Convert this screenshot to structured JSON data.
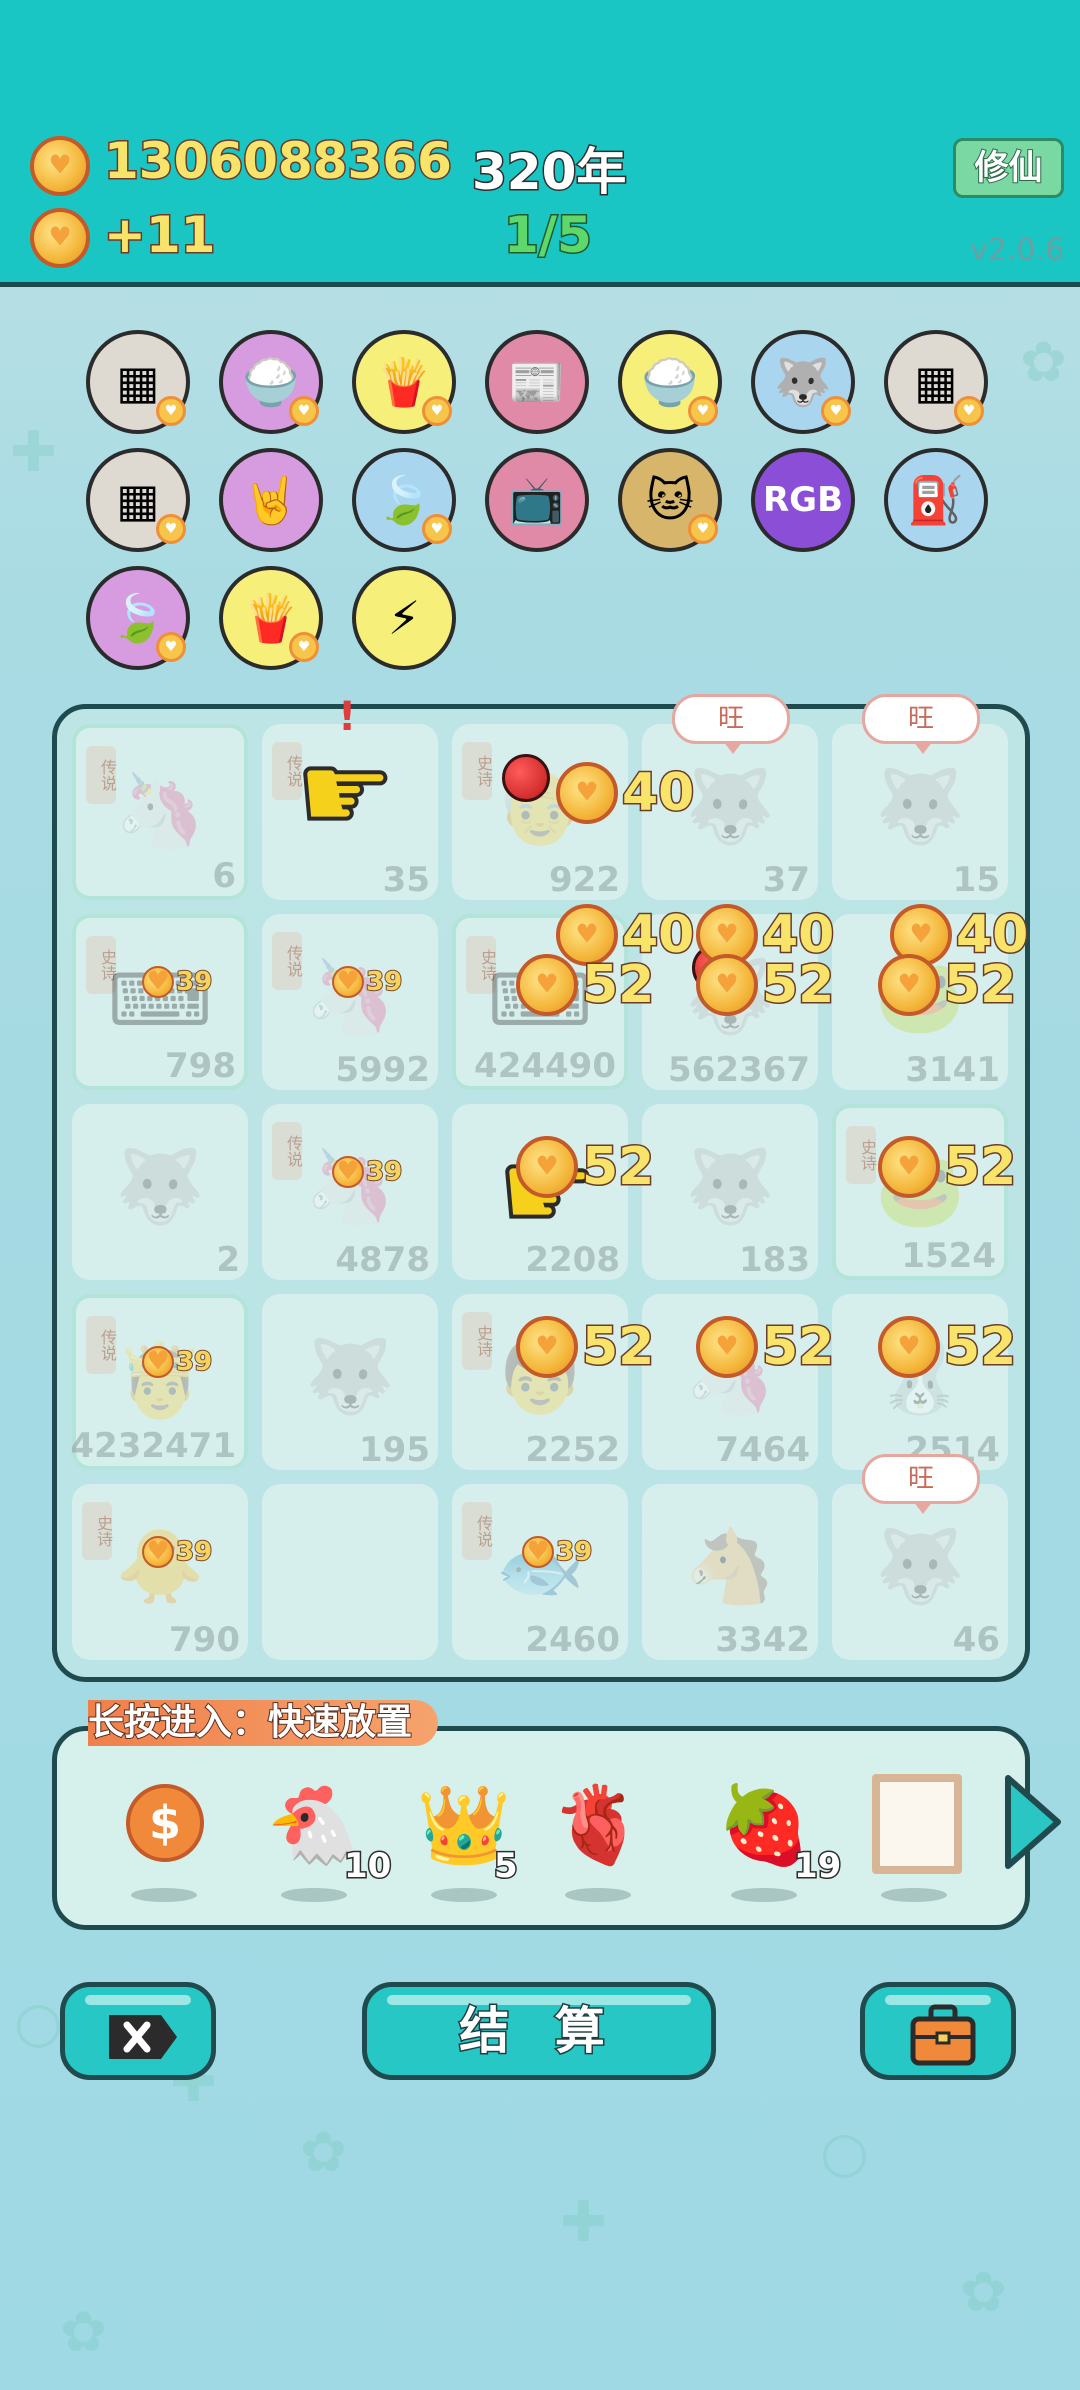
{
  "header": {
    "coins": "1306088366",
    "income": "+11",
    "year": "320年",
    "progress": "1/5",
    "mode_button": "修仙",
    "version": "v2.0.6"
  },
  "collection": {
    "items": [
      {
        "icon": "tofu-cubes-icon",
        "glyph": "▦",
        "bg": "#dedad2",
        "has_coin": true
      },
      {
        "icon": "rice-bowl-icon",
        "glyph": "🍚",
        "bg": "#d79be0",
        "has_coin": true
      },
      {
        "icon": "fries-icon",
        "glyph": "🍟",
        "bg": "#f6f07a",
        "has_coin": true
      },
      {
        "icon": "time-magazine-icon",
        "glyph": "📰",
        "bg": "#e08aa8",
        "has_coin": false
      },
      {
        "icon": "rice-bowl-icon",
        "glyph": "🍚",
        "bg": "#f6f07a",
        "has_coin": true
      },
      {
        "icon": "husky-icon",
        "glyph": "🐺",
        "bg": "#a9d5ee",
        "has_coin": true
      },
      {
        "icon": "tofu-cubes-icon",
        "glyph": "▦",
        "bg": "#dedad2",
        "has_coin": true
      },
      {
        "icon": "tofu-cubes-icon",
        "glyph": "▦",
        "bg": "#dedad2",
        "has_coin": true
      },
      {
        "icon": "rock-hand-icon",
        "glyph": "🤘",
        "bg": "#d79be0",
        "has_coin": false
      },
      {
        "icon": "leaf-icon",
        "glyph": "🍃",
        "bg": "#a9d5ee",
        "has_coin": true
      },
      {
        "icon": "tv-cow-icon",
        "glyph": "📺",
        "bg": "#e08aa8",
        "has_coin": false
      },
      {
        "icon": "cat-pair-icon",
        "glyph": "🐱",
        "bg": "#d7b56a",
        "has_coin": true
      },
      {
        "icon": "rgb-icon",
        "glyph": "RGB",
        "bg": "#8a4fd6",
        "has_coin": false
      },
      {
        "icon": "pump-icon",
        "glyph": "⛽",
        "bg": "#a9d5ee",
        "has_coin": false
      },
      {
        "icon": "leaf-icon",
        "glyph": "🍃",
        "bg": "#d79be0",
        "has_coin": true
      },
      {
        "icon": "fries-icon",
        "glyph": "🍟",
        "bg": "#f6f07a",
        "has_coin": true
      },
      {
        "icon": "lightning-icon",
        "glyph": "⚡",
        "bg": "#f6f07a",
        "has_coin": false
      }
    ]
  },
  "board": {
    "cells": [
      {
        "num": "6",
        "tag": "传说",
        "icon": "unicorn-icon",
        "glyph": "🦄",
        "framed": true
      },
      {
        "num": "35",
        "tag": "传说",
        "icon": "empty",
        "glyph": "",
        "framed": false
      },
      {
        "num": "922",
        "tag": "史诗",
        "icon": "grandpa-icon",
        "glyph": "👴",
        "framed": false
      },
      {
        "num": "37",
        "tag": "",
        "icon": "husky-icon",
        "glyph": "🐺",
        "framed": false
      },
      {
        "num": "15",
        "tag": "",
        "icon": "husky-icon",
        "glyph": "🐺",
        "framed": false
      },
      {
        "num": "798",
        "tag": "史诗",
        "icon": "ctrl-keys-icon",
        "glyph": "⌨",
        "framed": true
      },
      {
        "num": "5992",
        "tag": "传说",
        "icon": "unicorn-icon",
        "glyph": "🦄",
        "framed": false
      },
      {
        "num": "424490",
        "tag": "史诗",
        "icon": "ctrl-keys-icon",
        "glyph": "⌨",
        "framed": true
      },
      {
        "num": "562367",
        "tag": "",
        "icon": "husky-icon",
        "glyph": "🐺",
        "framed": false
      },
      {
        "num": "3141",
        "tag": "",
        "icon": "frog-icon",
        "glyph": "🐸",
        "framed": false
      },
      {
        "num": "2",
        "tag": "",
        "icon": "husky-icon",
        "glyph": "🐺",
        "framed": false
      },
      {
        "num": "4878",
        "tag": "传说",
        "icon": "unicorn-icon",
        "glyph": "🦄",
        "framed": false
      },
      {
        "num": "2208",
        "tag": "",
        "icon": "empty",
        "glyph": "",
        "framed": false
      },
      {
        "num": "183",
        "tag": "",
        "icon": "husky-icon",
        "glyph": "🐺",
        "framed": false
      },
      {
        "num": "1524",
        "tag": "史诗",
        "icon": "frog-icon",
        "glyph": "🐸",
        "framed": true
      },
      {
        "num": "4232471",
        "tag": "传说",
        "icon": "king-icon",
        "glyph": "🤴",
        "framed": true
      },
      {
        "num": "195",
        "tag": "",
        "icon": "husky-icon",
        "glyph": "🐺",
        "framed": false
      },
      {
        "num": "2252",
        "tag": "史诗",
        "icon": "boy-icon",
        "glyph": "👦",
        "framed": false
      },
      {
        "num": "7464",
        "tag": "",
        "icon": "unicorn-icon",
        "glyph": "🦄",
        "framed": false
      },
      {
        "num": "2514",
        "tag": "",
        "icon": "rabbit-icon",
        "glyph": "🐰",
        "framed": false
      },
      {
        "num": "790",
        "tag": "史诗",
        "icon": "chick-icon",
        "glyph": "🐥",
        "framed": false
      },
      {
        "num": "",
        "tag": "",
        "icon": "empty",
        "glyph": "",
        "framed": false
      },
      {
        "num": "2460",
        "tag": "传说",
        "icon": "fish-icon",
        "glyph": "🐟",
        "framed": false
      },
      {
        "num": "3342",
        "tag": "",
        "icon": "horse-icon",
        "glyph": "🐴",
        "framed": false
      },
      {
        "num": "46",
        "tag": "",
        "icon": "husky-icon",
        "glyph": "🐺",
        "framed": false
      }
    ],
    "bubbles": [
      "旺",
      "旺",
      "旺"
    ],
    "floats_big": [
      "40",
      "40",
      "40",
      "40",
      "52",
      "52",
      "52",
      "52",
      "52",
      "52",
      "52",
      "52"
    ],
    "floats_small": [
      "39",
      "39",
      "39",
      "39",
      "39",
      "39",
      "39"
    ]
  },
  "tray": {
    "label": "长按进入：快速放置",
    "items": [
      {
        "icon": "dollar-coin-icon",
        "glyph": "$",
        "count": ""
      },
      {
        "icon": "chicken-icon",
        "glyph": "🐔",
        "count": "10"
      },
      {
        "icon": "crown-icon",
        "glyph": "👑",
        "count": "5"
      },
      {
        "icon": "liver-icon",
        "glyph": "🫀",
        "count": ""
      },
      {
        "icon": "strawberry-icon",
        "glyph": "🍓",
        "count": "19"
      },
      {
        "icon": "frame-icon",
        "glyph": "▢",
        "count": ""
      }
    ]
  },
  "buttons": {
    "settle": "结 算"
  },
  "colors": {
    "header_bg": "#1ac6c3",
    "accent": "#26c7c5",
    "coin_text": "#f8e46a",
    "progress": "#5ed86b"
  }
}
